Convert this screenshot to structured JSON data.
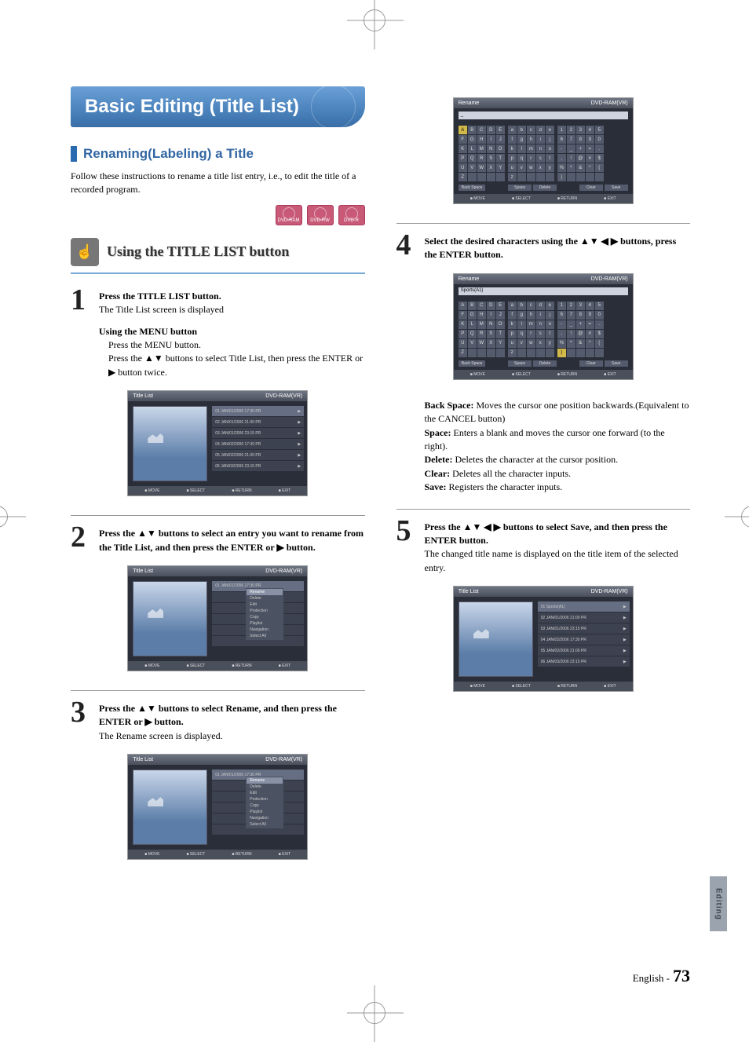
{
  "banner_title": "Basic Editing (Title List)",
  "section_header": "Renaming(Labeling) a Title",
  "intro": "Follow these instructions to rename a title list entry, i.e., to edit the title of a recorded program.",
  "disc_labels": [
    "DVD-RAM",
    "DVD-RW",
    "DVD-R"
  ],
  "subheader": "Using the TITLE LIST button",
  "steps": {
    "s1_bold": "Press the TITLE LIST button.",
    "s1_sub": "The Title List screen is displayed",
    "s1_menu_hdr": "Using the MENU button",
    "s1_menu_a": "Press the MENU button.",
    "s1_menu_b": "Press the ▲▼ buttons to select Title List, then press the ENTER or ▶ button twice.",
    "s2": "Press the ▲▼ buttons to select an entry you want to rename from the Title List, and then press the ENTER or ▶ button.",
    "s3_bold": "Press the ▲▼ buttons to select Rename, and then press the ENTER or ▶ button.",
    "s3_sub": "The Rename screen is displayed.",
    "s4": "Select the desired characters using the ▲▼ ◀ ▶ buttons, press the ENTER button.",
    "s5_bold": "Press the ▲▼ ◀ ▶ buttons to select Save, and then press the ENTER button.",
    "s5_sub": "The changed title name is displayed on the title item of the selected entry."
  },
  "defs": {
    "backspace_term": "Back Space:",
    "backspace_txt": " Moves the cursor one position backwards.(Equivalent to the CANCEL button)",
    "space_term": "Space:",
    "space_txt": " Enters a blank and moves the cursor one forward (to the right).",
    "delete_term": "Delete:",
    "delete_txt": " Deletes the character at the cursor position.",
    "clear_term": "Clear:",
    "clear_txt": " Deletes all the character inputs.",
    "save_term": "Save:",
    "save_txt": " Registers the character inputs."
  },
  "dvd_ui": {
    "title_list": "Title List",
    "rename": "Rename",
    "dvd_ram_time": "DVD-RAM(VR)",
    "entries": [
      "01  JAN/01/2006 17:30 PR",
      "02  JAN/01/2006 21:00 PR",
      "03  JAN/01/2006 23:15 PR",
      "04  JAN/02/2006 17:30 PR",
      "05  JAN/02/2006 21:00 PR",
      "06  JAN/03/2006 23:15 PR"
    ],
    "menu_items": [
      "Rename",
      "Delete",
      "Edit",
      "Protection",
      "Copy",
      "Playlist",
      "Navigation",
      "Select All"
    ],
    "bottom": [
      "MOVE",
      "SELECT",
      "RETURN",
      "EXIT"
    ],
    "kb_upper": [
      "A",
      "B",
      "C",
      "D",
      "E",
      "F",
      "G",
      "H",
      "I",
      "J",
      "K",
      "L",
      "M",
      "N",
      "O",
      "P",
      "Q",
      "R",
      "S",
      "T",
      "U",
      "V",
      "W",
      "X",
      "Y",
      "Z",
      "",
      "",
      "",
      ""
    ],
    "kb_lower": [
      "a",
      "b",
      "c",
      "d",
      "e",
      "f",
      "g",
      "h",
      "i",
      "j",
      "k",
      "l",
      "m",
      "n",
      "o",
      "p",
      "q",
      "r",
      "s",
      "t",
      "u",
      "v",
      "w",
      "x",
      "y",
      "z",
      "",
      "",
      "",
      ""
    ],
    "kb_sym": [
      "1",
      "2",
      "3",
      "4",
      "5",
      "6",
      "7",
      "8",
      "9",
      "0",
      "-",
      "_",
      "+",
      "=",
      ".",
      ",",
      "!",
      "@",
      "#",
      "$",
      "%",
      "^",
      "&",
      "*",
      "(",
      ")",
      "",
      "",
      "",
      ""
    ],
    "kb_controls_left": "Back Space",
    "kb_controls_mid": [
      "Space",
      "Delete"
    ],
    "kb_controls_right": [
      "Clear",
      "Save"
    ]
  },
  "side_tab": "Editing",
  "footer_lang": "English -",
  "footer_page": "73"
}
